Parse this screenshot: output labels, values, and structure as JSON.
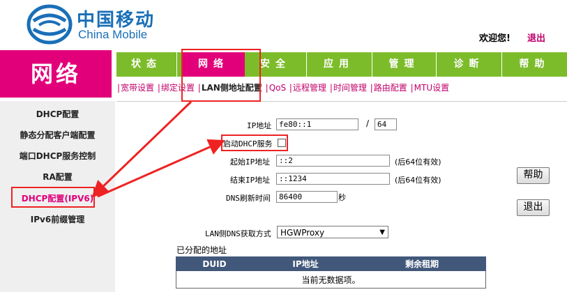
{
  "brand": {
    "name_cn": "中国移动",
    "name_en": "China Mobile"
  },
  "header": {
    "welcome": "欢迎您!",
    "logout": "退出"
  },
  "section": {
    "title": "网络"
  },
  "tabs": [
    {
      "label": "状态"
    },
    {
      "label": "网络"
    },
    {
      "label": "安全"
    },
    {
      "label": "应用"
    },
    {
      "label": "管理"
    },
    {
      "label": "诊断"
    },
    {
      "label": "帮助"
    }
  ],
  "subnav": {
    "items": [
      "宽带设置",
      "绑定设置",
      "LAN侧地址配置",
      "QoS",
      "远程管理",
      "时间管理",
      "路由配置",
      "MTU设置"
    ],
    "active": "LAN侧地址配置"
  },
  "sidebar": {
    "items": [
      "DHCP配置",
      "静态分配客户端配置",
      "端口DHCP服务控制",
      "RA配置",
      "DHCP配置(IPV6)",
      "IPv6前缀管理"
    ]
  },
  "form": {
    "ip_label": "IP地址",
    "ip_value": "fe80::1",
    "slash": "/",
    "prefix_len": "64",
    "dhcp_enable_label": "启动DHCP服务",
    "dhcp_enabled": false,
    "start_ip_label": "起始IP地址",
    "start_ip_value": "::2",
    "end_ip_label": "结束IP地址",
    "end_ip_value": "::1234",
    "suffix_note": "(后64位有效)",
    "dns_refresh_label": "DNS刷新时间",
    "dns_refresh_value": "86400",
    "dns_refresh_unit": "秒",
    "dns_mode_label": "LAN侧DNS获取方式",
    "dns_mode_value": "HGWProxy",
    "help_button": "帮助",
    "exit_button": "退出"
  },
  "assigned": {
    "title": "已分配的地址",
    "columns": [
      "DUID",
      "IP地址",
      "剩余租期"
    ],
    "empty_text": "当前无数据项。"
  },
  "colors": {
    "accent": "#e2007a",
    "tab_bg": "#7cbc2a",
    "highlight": "#ee2222",
    "table_header": "#41587a",
    "brand": "#1a6fb7"
  }
}
